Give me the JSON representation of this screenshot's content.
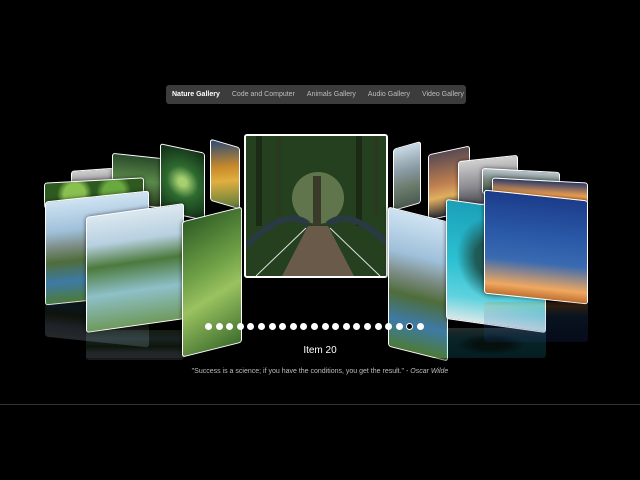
{
  "tabs": [
    {
      "label": "Nature Gallery",
      "active": true
    },
    {
      "label": "Code and Computer",
      "active": false
    },
    {
      "label": "Animals Gallery",
      "active": false
    },
    {
      "label": "Audio Gallery",
      "active": false
    },
    {
      "label": "Video Gallery",
      "active": false
    }
  ],
  "current_item": {
    "title": "Item 20",
    "quote": "\"Success is a science; if you have the conditions, you get the result.\" - ",
    "author": "Oscar Wilde"
  },
  "pagination": {
    "total": 21,
    "active_index": 20
  },
  "colors": {
    "background": "#000000",
    "tab_bar": "#464646",
    "card_border": "#ffffff"
  },
  "cards": [
    {
      "name": "card-forest-bridge",
      "image": "forest-bridge"
    },
    {
      "name": "card-mountain-lake",
      "image": "mountain-lake"
    },
    {
      "name": "card-waterfalls",
      "image": "waterfalls"
    },
    {
      "name": "card-green-hills",
      "image": "green-hills"
    },
    {
      "name": "card-reef-island",
      "image": "reef-island"
    },
    {
      "name": "card-palm-sunset",
      "image": "palm-sunset"
    }
  ]
}
